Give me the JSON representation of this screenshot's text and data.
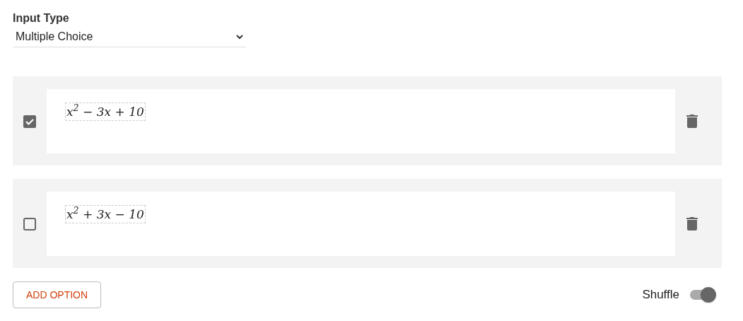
{
  "input_type": {
    "label": "Input Type",
    "value": "Multiple Choice"
  },
  "options": [
    {
      "expression": "x$^{2}$ − 3x + 10",
      "checked": true
    },
    {
      "expression": "x$^{2}$ + 3x − 10",
      "checked": false
    }
  ],
  "add_button": "ADD OPTION",
  "shuffle": {
    "label": "Shuffle",
    "on": true
  }
}
